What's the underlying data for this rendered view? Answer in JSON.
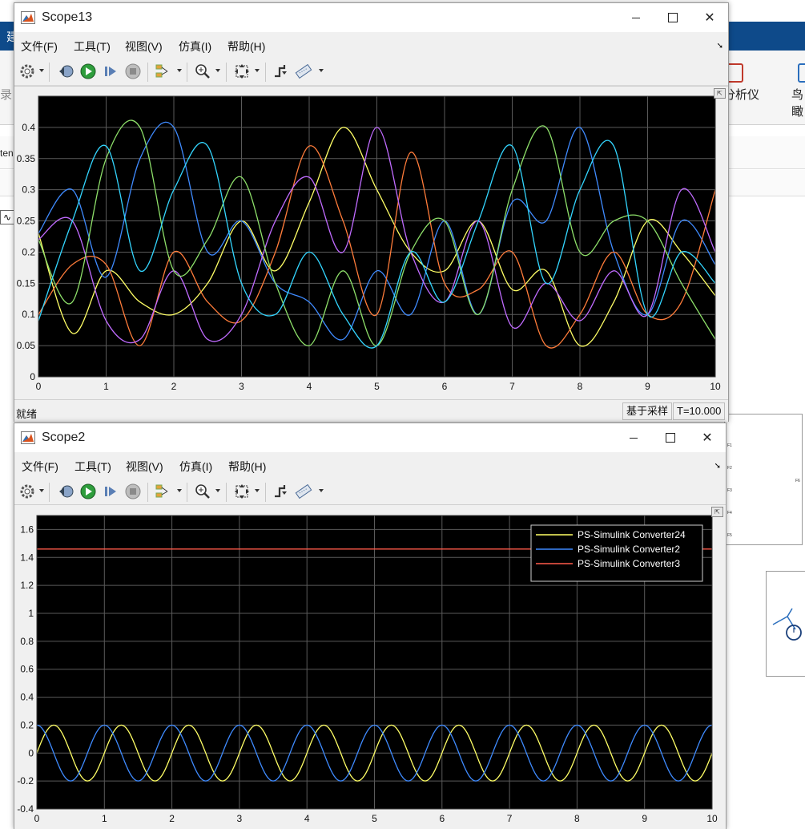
{
  "background": {
    "ribbon_left": "建",
    "left_label_1": "录",
    "left_label_2": "ten",
    "right_label_1": "分析仪",
    "right_label_2": "鸟瞰",
    "scope_symbol": "∿",
    "ports": [
      "F1",
      "F2",
      "F3",
      "F4",
      "F5"
    ],
    "port_out": "F6"
  },
  "scope13": {
    "title": "Scope13",
    "menu": [
      "文件(F)",
      "工具(T)",
      "视图(V)",
      "仿真(I)",
      "帮助(H)"
    ],
    "status_left": "就绪",
    "status_mode": "基于采样",
    "status_time": "T=10.000"
  },
  "scope2": {
    "title": "Scope2",
    "menu": [
      "文件(F)",
      "工具(T)",
      "视图(V)",
      "仿真(I)",
      "帮助(H)"
    ]
  },
  "icons": {
    "settings": "gear-icon",
    "step_back": "step-back-icon",
    "run": "run-icon",
    "step_forward": "step-forward-icon",
    "stop": "stop-icon",
    "highlight": "highlight-simulink-block-icon",
    "zoom": "zoom-icon",
    "autoscale": "autoscale-icon",
    "triggers": "triggers-icon",
    "measurements": "measurements-icon"
  },
  "colors": {
    "plot_bg": "#000000",
    "axes_text": "#111111",
    "grid": "#5a5a5a",
    "yellow": "#ffff66",
    "blue": "#3f8bff",
    "red": "#ff5a4a",
    "cyan": "#33d6ff",
    "green": "#8ee06a",
    "purple": "#c06bff",
    "orange": "#ff7c3a"
  },
  "chart_data": [
    {
      "type": "line",
      "title": "",
      "xlabel": "",
      "ylabel": "",
      "xlim": [
        0,
        10
      ],
      "ylim": [
        0,
        0.45
      ],
      "xticks": [
        "0",
        "1",
        "2",
        "3",
        "4",
        "5",
        "6",
        "7",
        "8",
        "9",
        "10"
      ],
      "yticks": [
        "0",
        "0.05",
        "0.1",
        "0.15",
        "0.2",
        "0.25",
        "0.3",
        "0.35",
        "0.4"
      ],
      "grid": true,
      "series": [
        {
          "color": "#ffff66",
          "x": [
            0,
            0.5,
            1,
            1.5,
            2,
            2.5,
            3,
            3.5,
            4,
            4.5,
            5,
            5.5,
            6,
            6.5,
            7,
            7.5,
            8,
            8.5,
            9,
            9.5,
            10
          ],
          "y": [
            0.23,
            0.07,
            0.17,
            0.12,
            0.1,
            0.15,
            0.25,
            0.17,
            0.28,
            0.4,
            0.3,
            0.2,
            0.17,
            0.25,
            0.14,
            0.17,
            0.05,
            0.12,
            0.25,
            0.2,
            0.13
          ]
        },
        {
          "color": "#3f8bff",
          "x": [
            0,
            0.5,
            1,
            1.5,
            2,
            2.5,
            3,
            3.5,
            4,
            4.5,
            5,
            5.5,
            6,
            6.5,
            7,
            7.5,
            8,
            8.5,
            9,
            9.5,
            10
          ],
          "y": [
            0.23,
            0.3,
            0.16,
            0.35,
            0.4,
            0.2,
            0.25,
            0.15,
            0.12,
            0.06,
            0.17,
            0.1,
            0.25,
            0.1,
            0.28,
            0.25,
            0.4,
            0.2,
            0.1,
            0.25,
            0.18
          ]
        },
        {
          "color": "#ff7c3a",
          "x": [
            0,
            0.5,
            1,
            1.5,
            2,
            2.5,
            3,
            3.5,
            4,
            4.5,
            5,
            5.5,
            6,
            6.5,
            7,
            7.5,
            8,
            8.5,
            9,
            9.5,
            10
          ],
          "y": [
            0.1,
            0.18,
            0.18,
            0.05,
            0.2,
            0.12,
            0.09,
            0.2,
            0.37,
            0.25,
            0.1,
            0.36,
            0.15,
            0.14,
            0.2,
            0.05,
            0.1,
            0.2,
            0.1,
            0.12,
            0.3
          ]
        },
        {
          "color": "#c06bff",
          "x": [
            0,
            0.5,
            1,
            1.5,
            2,
            2.5,
            3,
            3.5,
            4,
            4.5,
            5,
            5.5,
            6,
            6.5,
            7,
            7.5,
            8,
            8.5,
            9,
            9.5,
            10
          ],
          "y": [
            0.22,
            0.25,
            0.09,
            0.06,
            0.17,
            0.06,
            0.1,
            0.25,
            0.32,
            0.2,
            0.4,
            0.2,
            0.12,
            0.25,
            0.08,
            0.15,
            0.09,
            0.17,
            0.1,
            0.3,
            0.2
          ]
        },
        {
          "color": "#8ee06a",
          "x": [
            0,
            0.5,
            1,
            1.5,
            2,
            2.5,
            3,
            3.5,
            4,
            4.5,
            5,
            5.5,
            6,
            6.5,
            7,
            7.5,
            8,
            8.5,
            9,
            9.5,
            10
          ],
          "y": [
            0.22,
            0.12,
            0.35,
            0.4,
            0.17,
            0.22,
            0.32,
            0.15,
            0.05,
            0.17,
            0.05,
            0.2,
            0.25,
            0.1,
            0.3,
            0.4,
            0.2,
            0.25,
            0.25,
            0.15,
            0.06
          ]
        },
        {
          "color": "#33d6ff",
          "x": [
            0,
            0.5,
            1,
            1.5,
            2,
            2.5,
            3,
            3.5,
            4,
            4.5,
            5,
            5.5,
            6,
            6.5,
            7,
            7.5,
            8,
            8.5,
            9,
            9.5,
            10
          ],
          "y": [
            0.09,
            0.25,
            0.37,
            0.17,
            0.3,
            0.37,
            0.15,
            0.1,
            0.2,
            0.1,
            0.05,
            0.2,
            0.12,
            0.25,
            0.37,
            0.15,
            0.3,
            0.37,
            0.1,
            0.2,
            0.15
          ]
        }
      ]
    },
    {
      "type": "line",
      "title": "",
      "xlabel": "",
      "ylabel": "",
      "xlim": [
        0,
        10
      ],
      "ylim": [
        -0.4,
        1.7
      ],
      "xticks": [
        "0",
        "1",
        "2",
        "3",
        "4",
        "5",
        "6",
        "7",
        "8",
        "9",
        "10"
      ],
      "yticks": [
        "-0.4",
        "-0.2",
        "0",
        "0.2",
        "0.4",
        "0.6",
        "0.8",
        "1",
        "1.2",
        "1.4",
        "1.6"
      ],
      "grid": true,
      "legend": "top-right",
      "series": [
        {
          "name": "PS-Simulink Converter24",
          "color": "#ffff66",
          "kind": "sine",
          "amplitude": 0.2,
          "period": 1.0,
          "phase": 0.0
        },
        {
          "name": "PS-Simulink Converter2",
          "color": "#3f8bff",
          "kind": "cosine",
          "amplitude": 0.2,
          "period": 1.0,
          "phase": 0.0
        },
        {
          "name": "PS-Simulink Converter3",
          "color": "#ff5a4a",
          "kind": "constant",
          "value": 1.46
        }
      ]
    }
  ]
}
